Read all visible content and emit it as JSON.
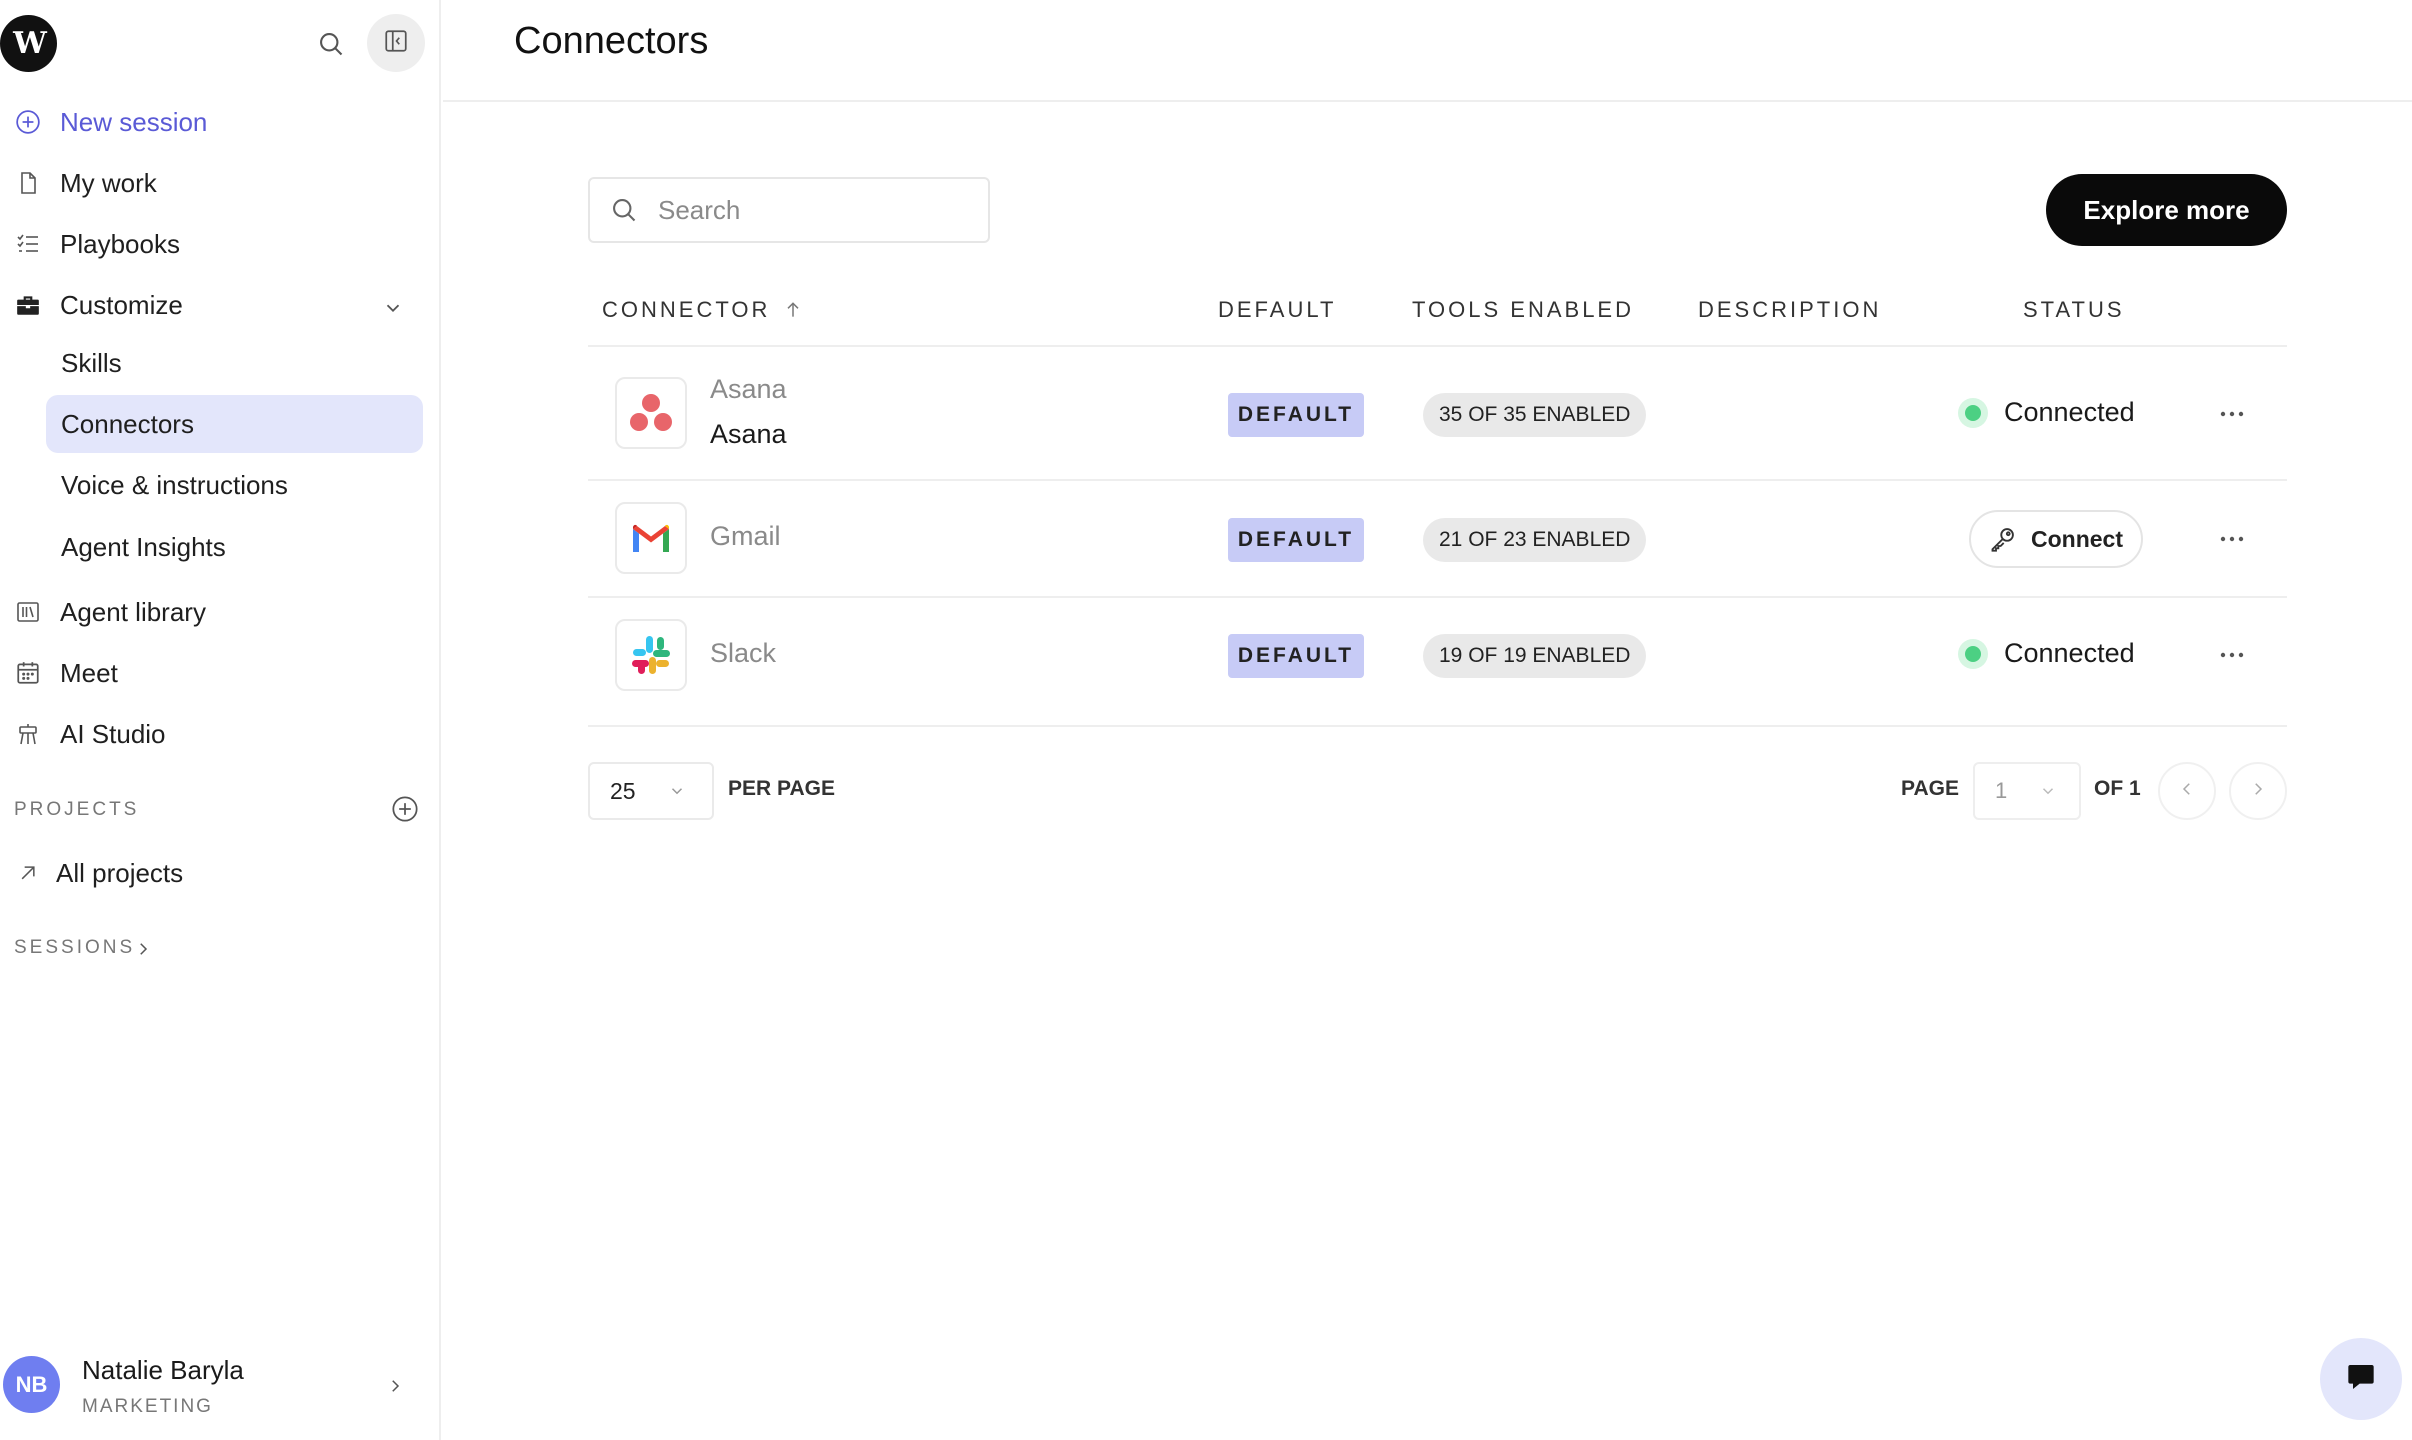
{
  "sidebar": {
    "logo_text": "W",
    "new_session": "New session",
    "items": {
      "my_work": "My work",
      "playbooks": "Playbooks",
      "customize": "Customize",
      "agent_library": "Agent library",
      "meet": "Meet",
      "ai_studio": "AI Studio"
    },
    "customize_sub": {
      "skills": "Skills",
      "connectors": "Connectors",
      "voice": "Voice & instructions",
      "insights": "Agent Insights"
    },
    "projects_label": "PROJECTS",
    "all_projects": "All projects",
    "sessions_label": "SESSIONS",
    "user": {
      "initials": "NB",
      "name": "Natalie Baryla",
      "role": "MARKETING"
    }
  },
  "main": {
    "title": "Connectors",
    "search_placeholder": "Search",
    "explore_label": "Explore more",
    "columns": {
      "connector": "CONNECTOR",
      "default": "DEFAULT",
      "tools": "TOOLS ENABLED",
      "description": "DESCRIPTION",
      "status": "STATUS"
    },
    "rows": [
      {
        "name": "Asana",
        "subtitle": "Asana",
        "default": "DEFAULT",
        "tools": "35 OF 35 ENABLED",
        "status": "Connected"
      },
      {
        "name": "Gmail",
        "default": "DEFAULT",
        "tools": "21 OF 23 ENABLED",
        "status": "Connect"
      },
      {
        "name": "Slack",
        "default": "DEFAULT",
        "tools": "19 OF 19 ENABLED",
        "status": "Connected"
      }
    ],
    "pagination": {
      "per_page_value": "25",
      "per_page_label": "PER PAGE",
      "page_label": "PAGE",
      "page_value": "1",
      "of_label": "OF 1"
    }
  },
  "colors": {
    "accent": "#5a5ad6",
    "active_nav": "#e3e6fb",
    "default_badge": "#c7cbf6",
    "connected_dot": "#4cd083",
    "primary_button": "#0a0a0a"
  },
  "icons": {
    "logo": "w-logo-icon",
    "search": "search-icon",
    "collapse": "sidebar-collapse-icon",
    "new_session": "plus-circle-icon",
    "my_work": "document-icon",
    "playbooks": "checklist-icon",
    "customize": "toolbox-icon",
    "agent_library": "library-icon",
    "meet": "calendar-icon",
    "ai_studio": "easel-icon",
    "all_projects": "arrow-up-right-icon",
    "connect": "key-icon",
    "more": "more-horizontal-icon",
    "chat": "chat-bubble-icon"
  }
}
